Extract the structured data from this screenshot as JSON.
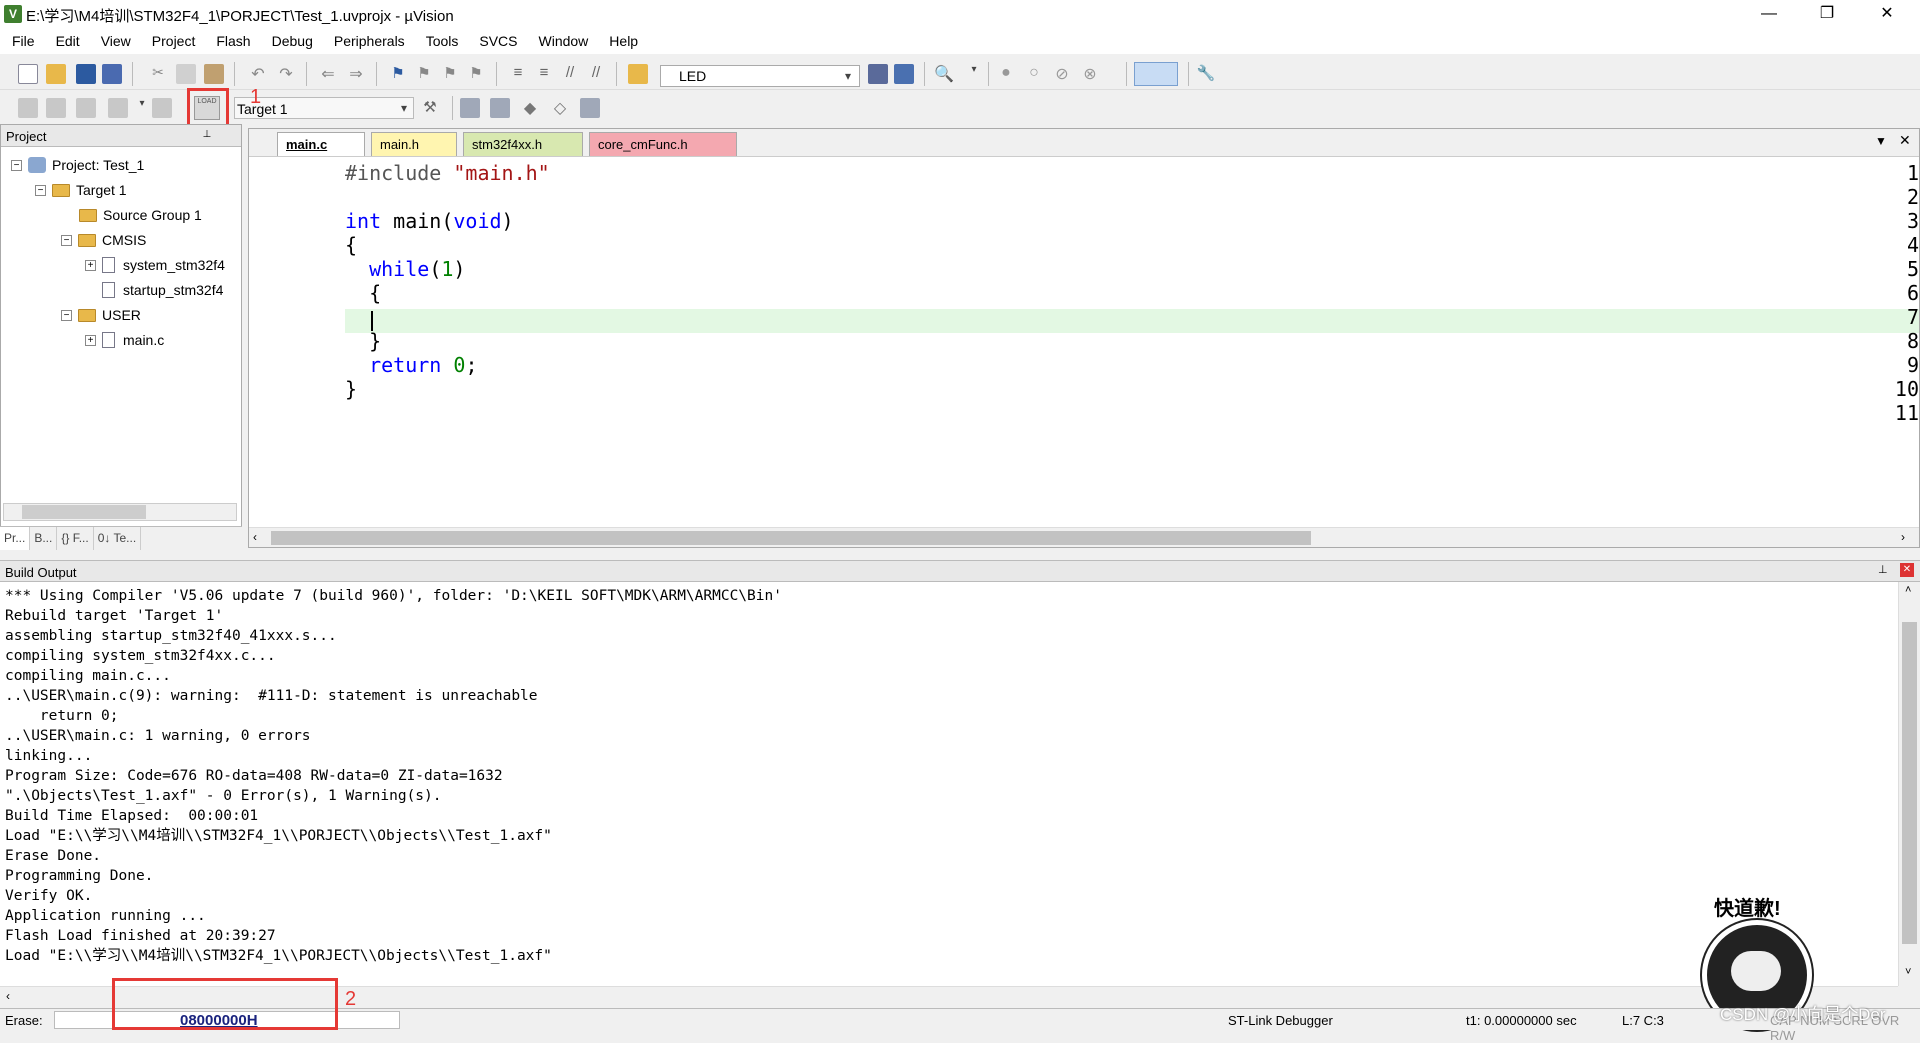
{
  "window": {
    "title": "E:\\学习\\M4培训\\STM32F4_1\\PORJECT\\Test_1.uvprojx - µVision",
    "app_icon": "V",
    "controls": [
      "—",
      "❐",
      "✕"
    ]
  },
  "menu": [
    "File",
    "Edit",
    "View",
    "Project",
    "Flash",
    "Debug",
    "Peripherals",
    "Tools",
    "SVCS",
    "Window",
    "Help"
  ],
  "toolbar": {
    "find_text": "LED",
    "target": "Target 1",
    "annotation_1": "1",
    "load_label": "LOAD"
  },
  "project": {
    "header": "Project",
    "tree": [
      {
        "label": "Project: Test_1"
      },
      {
        "label": "Target 1"
      },
      {
        "label": "Source Group 1"
      },
      {
        "label": "CMSIS"
      },
      {
        "label": "system_stm32f4"
      },
      {
        "label": "startup_stm32f4"
      },
      {
        "label": "USER"
      },
      {
        "label": "main.c"
      }
    ],
    "tabs": [
      "Pr...",
      "B...",
      "{} F...",
      "0↓ Te..."
    ]
  },
  "editor": {
    "tabs": [
      "main.c",
      "main.h",
      "stm32f4xx.h",
      "core_cmFunc.h"
    ],
    "line_numbers": [
      "1",
      "2",
      "3",
      "4",
      "5",
      "6",
      "7",
      "8",
      "9",
      "10",
      "11"
    ],
    "code": {
      "l1_pre": "#include",
      "l1_str": "\"main.h\"",
      "l3_kw1": "int",
      "l3_mid": " main(",
      "l3_kw2": "void",
      "l3_end": ")",
      "l4": "{",
      "l5_kw": "while",
      "l5_a": "(",
      "l5_num": "1",
      "l5_b": ")",
      "l6": "{",
      "l8": "}",
      "l9_kw": "return",
      "l9_num": "0",
      "l9_end": ";",
      "l10": "}"
    }
  },
  "build": {
    "header": "Build Output",
    "lines": [
      "*** Using Compiler 'V5.06 update 7 (build 960)', folder: 'D:\\KEIL SOFT\\MDK\\ARM\\ARMCC\\Bin'",
      "Rebuild target 'Target 1'",
      "assembling startup_stm32f40_41xxx.s...",
      "compiling system_stm32f4xx.c...",
      "compiling main.c...",
      "..\\USER\\main.c(9): warning:  #111-D: statement is unreachable",
      "    return 0;",
      "..\\USER\\main.c: 1 warning, 0 errors",
      "linking...",
      "Program Size: Code=676 RO-data=408 RW-data=0 ZI-data=1632",
      "\".\\Objects\\Test_1.axf\" - 0 Error(s), 1 Warning(s).",
      "Build Time Elapsed:  00:00:01",
      "Load \"E:\\\\学习\\\\M4培训\\\\STM32F4_1\\\\PORJECT\\\\Objects\\\\Test_1.axf\"",
      "Erase Done.",
      "Programming Done.",
      "Verify OK.",
      "Application running ...",
      "Flash Load finished at 20:39:27",
      "Load \"E:\\\\学习\\\\M4培训\\\\STM32F4_1\\\\PORJECT\\\\Objects\\\\Test_1.axf\""
    ]
  },
  "status": {
    "erase_label": "Erase:",
    "address": "08000000H",
    "annotation_2": "2",
    "debugger": "ST-Link Debugger",
    "time": "t1: 0.00000000 sec",
    "cursor": "L:7 C:3",
    "modes": "CAP NUM SCRL OVR R/W"
  },
  "watermark": {
    "sticker_text": "快道歉!",
    "csdn": "CSDN @小向是个Der"
  }
}
